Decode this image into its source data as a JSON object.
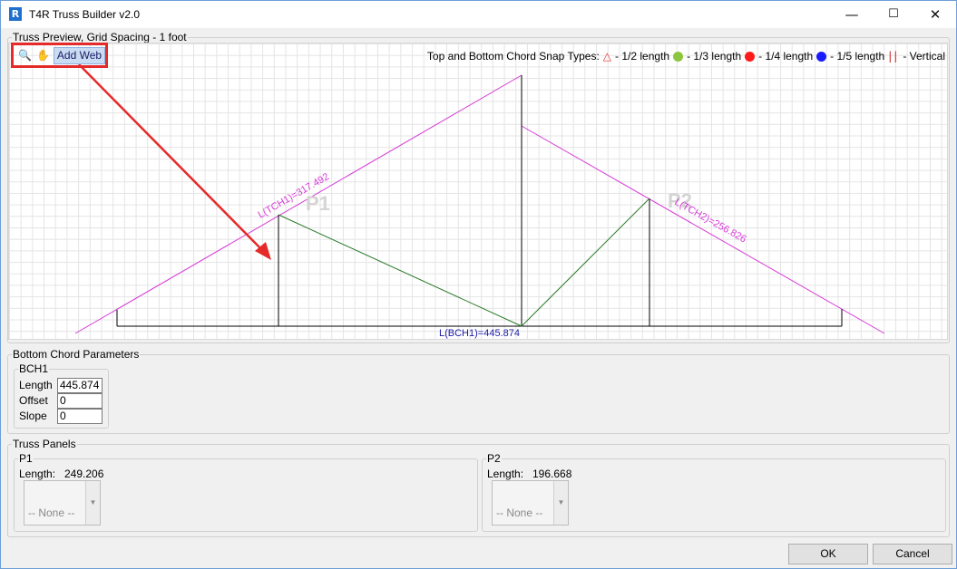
{
  "window": {
    "title": "T4R Truss Builder v2.0",
    "app_icon_letter": "R",
    "minimize_glyph": "—",
    "maximize_glyph": "☐",
    "close_glyph": "✕"
  },
  "preview": {
    "group_label": "Truss Preview, Grid Spacing - 1 foot",
    "toolbar": {
      "zoom_icon": "zoom-icon",
      "pan_icon": "hand-pan-icon",
      "add_web_label": "Add Web"
    },
    "snap_legend": {
      "title": "Top and Bottom Chord Snap Types:",
      "half": "- 1/2 length",
      "third": "- 1/3 length",
      "quarter": "- 1/4 length",
      "fifth": "- 1/5 length",
      "vertical": "- Vertical",
      "colors": {
        "half": "#e0302a",
        "third": "#8cc63f",
        "quarter": "#ff1a1a",
        "fifth": "#1a1aff",
        "vertical": "#d21a1a"
      }
    },
    "labels": {
      "tch1": "L(TCH1)=317.492",
      "tch2": "L(TCH2)=256.826",
      "bch1": "L(BCH1)=445.874",
      "p1": "P1",
      "p2": "P2"
    },
    "colors": {
      "top_chord": "#d63ad6",
      "web_diag": "#2a7a2a",
      "bottom_chord": "#000000",
      "arrow": "#e52a2a",
      "bch_label": "#1a1aa8"
    }
  },
  "bottom_chord": {
    "group_label": "Bottom Chord Parameters",
    "sub_label": "BCH1",
    "length_label": "Length",
    "length_value": "445.874",
    "offset_label": "Offset",
    "offset_value": "0",
    "slope_label": "Slope",
    "slope_value": "0"
  },
  "panels": {
    "group_label": "Truss Panels",
    "p1": {
      "label": "P1",
      "length_label": "Length:",
      "length_value": "249.206",
      "selected": "-- None --"
    },
    "p2": {
      "label": "P2",
      "length_label": "Length:",
      "length_value": "196.668",
      "selected": "-- None --"
    }
  },
  "buttons": {
    "ok": "OK",
    "cancel": "Cancel"
  }
}
